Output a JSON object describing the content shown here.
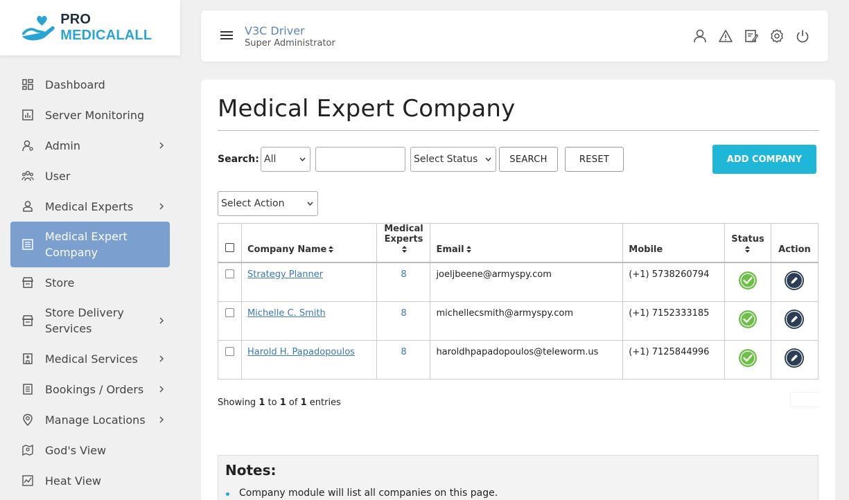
{
  "brand": {
    "pro": "PRO",
    "name": "MEDICALALL"
  },
  "colors": {
    "accent": "#1fb6d8",
    "active_menu": "#7b9fcf",
    "link": "#3a77b5",
    "status_ok": "#6cc04a",
    "edit_btn": "#2c3e55"
  },
  "sidebar": {
    "items": [
      {
        "label": "Dashboard",
        "icon": "dashboard-icon",
        "has_submenu": false
      },
      {
        "label": "Server Monitoring",
        "icon": "chart-icon",
        "has_submenu": false
      },
      {
        "label": "Admin",
        "icon": "admin-icon",
        "has_submenu": true
      },
      {
        "label": "User",
        "icon": "users-icon",
        "has_submenu": false
      },
      {
        "label": "Medical Experts",
        "icon": "person-icon",
        "has_submenu": true
      },
      {
        "label": "Medical Expert Company",
        "icon": "building-icon",
        "has_submenu": false,
        "active": true
      },
      {
        "label": "Store",
        "icon": "store-icon",
        "has_submenu": false
      },
      {
        "label": "Store Delivery Services",
        "icon": "store-icon",
        "has_submenu": true
      },
      {
        "label": "Medical Services",
        "icon": "hospital-icon",
        "has_submenu": true
      },
      {
        "label": "Bookings / Orders",
        "icon": "list-icon",
        "has_submenu": true
      },
      {
        "label": "Manage Locations",
        "icon": "location-icon",
        "has_submenu": true
      },
      {
        "label": "God's View",
        "icon": "map-icon",
        "has_submenu": false
      },
      {
        "label": "Heat View",
        "icon": "heatmap-icon",
        "has_submenu": false
      }
    ]
  },
  "header": {
    "user_name": "V3C Driver",
    "user_role": "Super Administrator",
    "icons": [
      "profile-icon",
      "warning-icon",
      "edit-note-icon",
      "settings-icon",
      "power-icon"
    ]
  },
  "page": {
    "title": "Medical Expert Company",
    "search": {
      "label": "Search:",
      "field_select": "All",
      "input_value": "",
      "status_select": "Select Status",
      "search_button": "SEARCH",
      "reset_button": "RESET"
    },
    "add_button": "ADD COMPANY",
    "action_select": "Select Action"
  },
  "table": {
    "columns": {
      "company_name": "Company Name",
      "medical_experts_1": "Medical",
      "medical_experts_2": "Experts",
      "email": "Email",
      "mobile": "Mobile",
      "status": "Status",
      "action": "Action"
    },
    "rows": [
      {
        "company": "Strategy Planner",
        "experts": "8",
        "email": "joeljbeene@armyspy.com",
        "mobile": "(+1) 5738260794",
        "status": "active"
      },
      {
        "company": "Michelle C. Smith",
        "experts": "8",
        "email": "michellecsmith@armyspy.com",
        "mobile": "(+1) 7152333185",
        "status": "active"
      },
      {
        "company": "Harold H. Papadopoulos",
        "experts": "8",
        "email": "haroldhpapadopoulos@teleworm.us",
        "mobile": "(+1) 7125844996",
        "status": "active"
      }
    ]
  },
  "pagination": {
    "showing_prefix": "Showing",
    "from": "1",
    "to_word": "to",
    "to": "1",
    "of_word": "of",
    "total": "1",
    "suffix": "entries"
  },
  "notes": {
    "title": "Notes:",
    "items": [
      "Company module will list all companies on this page."
    ]
  }
}
